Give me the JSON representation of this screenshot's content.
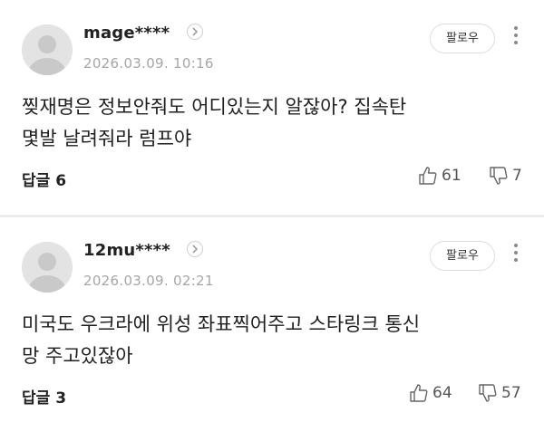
{
  "comments": [
    {
      "username": "mage****",
      "date": "2026.03.09. 10:16",
      "follow_label": "팔로우",
      "text_lines": [
        "찢재명은 정보안줘도 어디있는지 알잖아? 집속탄",
        "몇발 날려줘라 럼프야"
      ],
      "reply_label": "답글 6",
      "likes": "61",
      "dislikes": "7"
    },
    {
      "username": "12mu****",
      "date": "2026.03.09. 02:21",
      "follow_label": "팔로우",
      "text_lines": [
        "미국도 우크라에 위성 좌표찍어주고 스타링크 통신",
        "망 주고있잖아"
      ],
      "reply_label": "답글 3",
      "likes": "64",
      "dislikes": "57"
    }
  ],
  "icons": {
    "avatar": "default-avatar-icon",
    "chevron": "chevron-right-icon",
    "more": "more-vertical-icon",
    "like": "thumbs-up-icon",
    "dislike": "thumbs-down-icon"
  },
  "colors": {
    "background": "#ffffff",
    "meta": "#a6a6a6",
    "divider": "#ececec",
    "avatar_bg": "#e3e3e3"
  }
}
